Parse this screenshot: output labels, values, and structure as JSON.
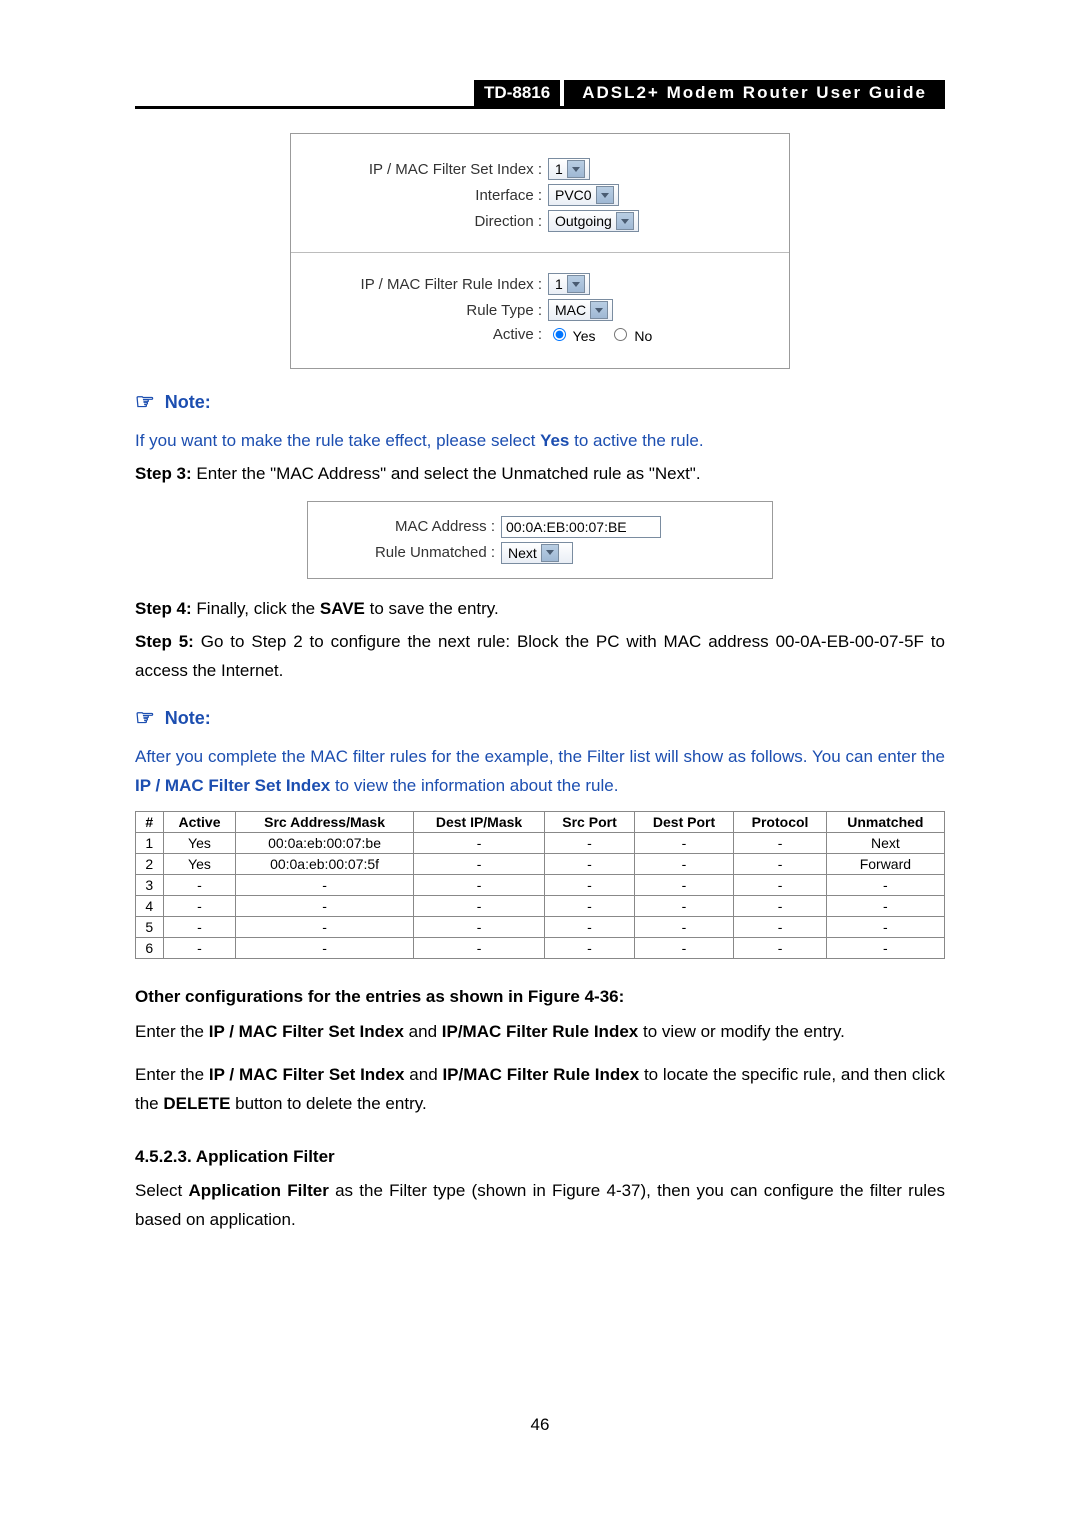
{
  "header": {
    "model": "TD-8816",
    "title": "ADSL2+  Modem  Router  User  Guide"
  },
  "panel1": {
    "set_index_label": "IP / MAC Filter Set Index :",
    "set_index_value": "1",
    "interface_label": "Interface :",
    "interface_value": "PVC0",
    "direction_label": "Direction :",
    "direction_value": "Outgoing",
    "rule_index_label": "IP / MAC Filter Rule Index :",
    "rule_index_value": "1",
    "rule_type_label": "Rule Type :",
    "rule_type_value": "MAC",
    "active_label": "Active :",
    "active_yes": "Yes",
    "active_no": "No"
  },
  "notes": {
    "title": "Note:"
  },
  "text1": {
    "note_line_a": "If you want to make the rule take effect, please select ",
    "note_line_b": "Yes",
    "note_line_c": " to active the rule.",
    "step3_a": "Step 3:",
    "step3_b": " Enter the \"MAC Address\" and select the Unmatched rule as \"Next\"."
  },
  "panel2": {
    "mac_label": "MAC Address :",
    "mac_value": "00:0A:EB:00:07:BE",
    "rule_unmatched_label": "Rule Unmatched :",
    "rule_unmatched_value": "Next"
  },
  "text2": {
    "step4_a": "Step 4:",
    "step4_b": " Finally, click the ",
    "step4_c": "SAVE",
    "step4_d": " to save the entry.",
    "step5_a": "Step 5:",
    "step5_b": " Go to Step 2 to configure the next rule: Block the PC with MAC address 00-0A-EB-00-07-5F to access the Internet."
  },
  "text3": {
    "note2_a": "After you complete the MAC filter rules for the example, the Filter list will show as follows. You can enter the ",
    "note2_b": "IP / MAC Filter Set Index",
    "note2_c": " to view the information about the rule."
  },
  "table": {
    "headers": [
      "#",
      "Active",
      "Src Address/Mask",
      "Dest IP/Mask",
      "Src Port",
      "Dest Port",
      "Protocol",
      "Unmatched"
    ],
    "rows": [
      {
        "n": "1",
        "active": "Yes",
        "src": "00:0a:eb:00:07:be",
        "dst": "-",
        "sp": "-",
        "dp": "-",
        "proto": "-",
        "un": "Next"
      },
      {
        "n": "2",
        "active": "Yes",
        "src": "00:0a:eb:00:07:5f",
        "dst": "-",
        "sp": "-",
        "dp": "-",
        "proto": "-",
        "un": "Forward"
      },
      {
        "n": "3",
        "active": "-",
        "src": "-",
        "dst": "-",
        "sp": "-",
        "dp": "-",
        "proto": "-",
        "un": "-"
      },
      {
        "n": "4",
        "active": "-",
        "src": "-",
        "dst": "-",
        "sp": "-",
        "dp": "-",
        "proto": "-",
        "un": "-"
      },
      {
        "n": "5",
        "active": "-",
        "src": "-",
        "dst": "-",
        "sp": "-",
        "dp": "-",
        "proto": "-",
        "un": "-"
      },
      {
        "n": "6",
        "active": "-",
        "src": "-",
        "dst": "-",
        "sp": "-",
        "dp": "-",
        "proto": "-",
        "un": "-"
      }
    ]
  },
  "text4": {
    "other_hdr": "Other configurations for the entries as shown in Figure 4-36:",
    "line1_a": "Enter the ",
    "line1_b": "IP / MAC Filter Set Index",
    "line1_c": " and ",
    "line1_d": "IP/MAC Filter Rule Index",
    "line1_e": " to view or modify the entry.",
    "line2_a": "Enter the ",
    "line2_b": "IP / MAC Filter Set Index",
    "line2_c": " and ",
    "line2_d": "IP/MAC Filter Rule Index",
    "line2_e": " to locate the specific rule, and then click the ",
    "line2_f": "DELETE",
    "line2_g": " button to delete the entry."
  },
  "section": {
    "hdr": "4.5.2.3.  Application Filter",
    "body_a": "Select ",
    "body_b": "Application Filter",
    "body_c": " as the Filter type (shown in Figure 4-37), then you can configure the filter rules based on application."
  },
  "page_number": "46"
}
